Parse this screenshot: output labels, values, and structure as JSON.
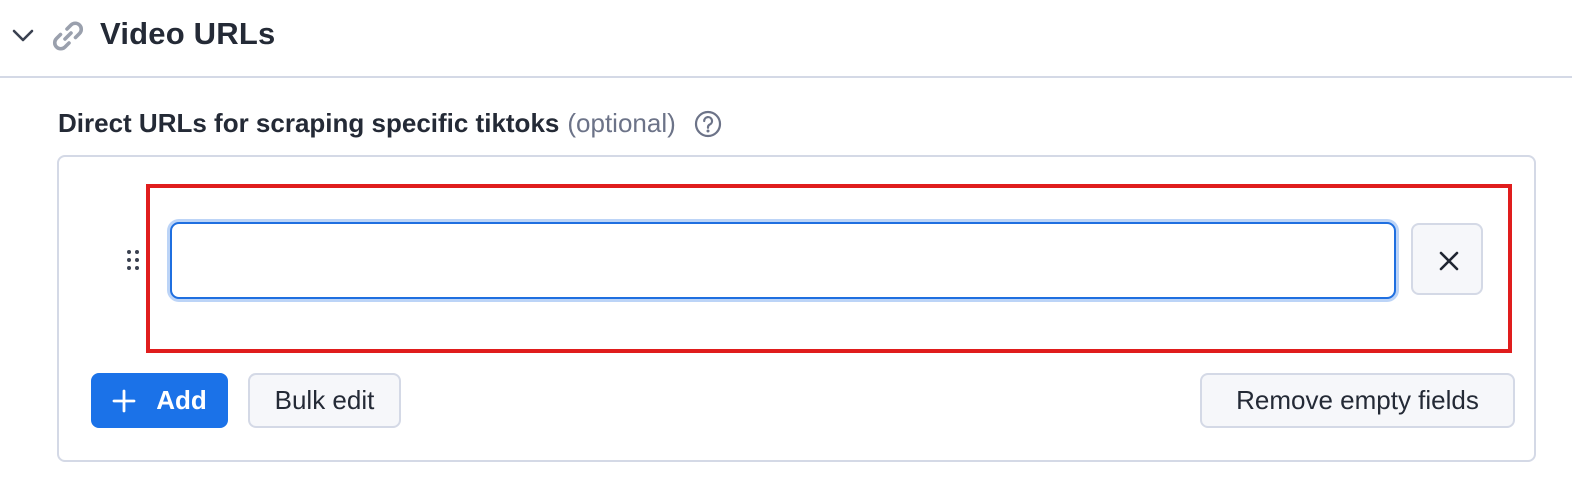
{
  "section": {
    "title": "Video URLs",
    "chevron_icon": "chevron-down-icon",
    "icon": "link-icon"
  },
  "field": {
    "label": "Direct URLs for scraping specific tiktoks",
    "optional_label": "(optional)",
    "help_icon": "question-circle-icon"
  },
  "list": {
    "items": [
      {
        "value": "",
        "placeholder": ""
      }
    ],
    "remove_item_icon": "close-icon",
    "drag_icon": "drag-handle-icon"
  },
  "actions": {
    "add_label": "Add",
    "bulk_edit_label": "Bulk edit",
    "remove_empty_label": "Remove empty fields"
  },
  "colors": {
    "primary": "#1b72e8",
    "focus_border": "#1f6fe0",
    "highlight": "#e01d1d",
    "border": "#d4d9e6"
  }
}
